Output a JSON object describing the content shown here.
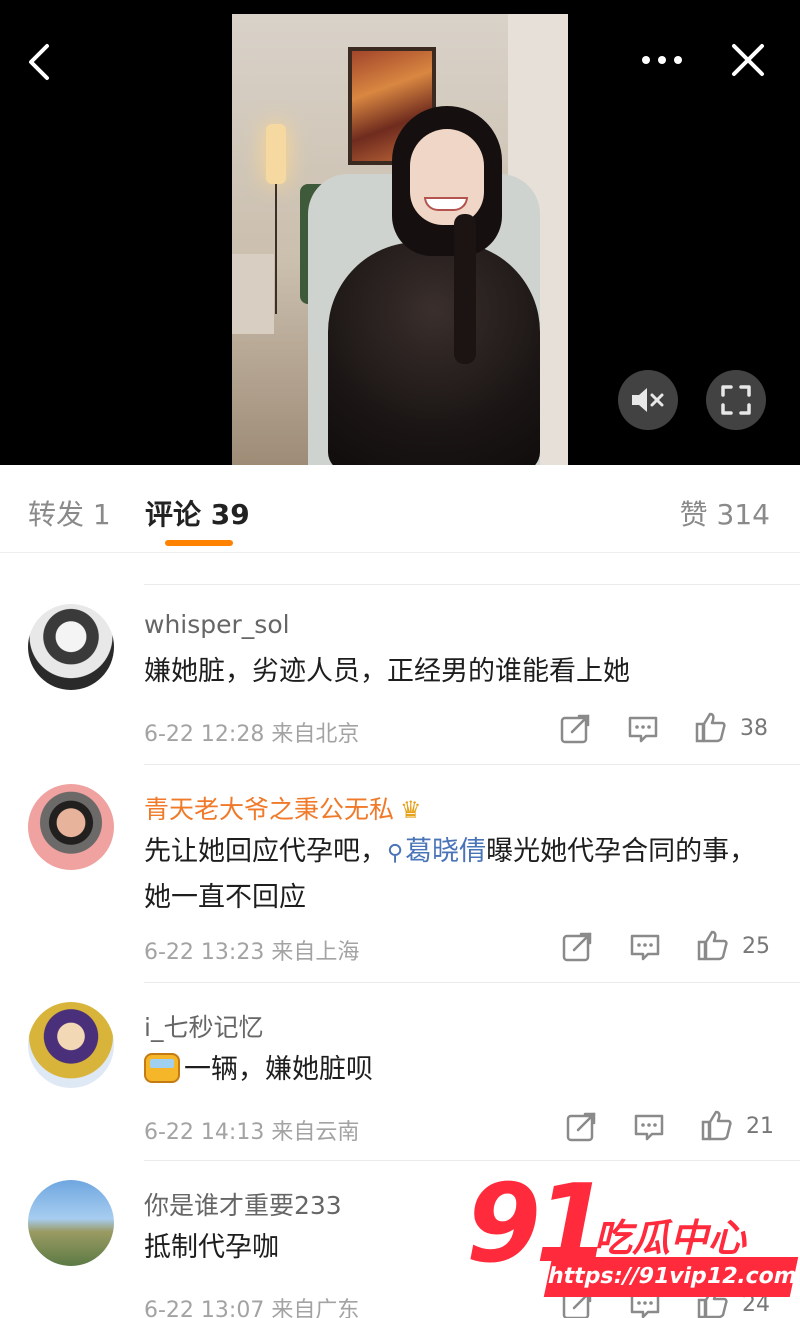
{
  "header": {
    "back_icon": "chevron-left-icon",
    "more_icon": "more-horizontal-icon",
    "close_icon": "close-icon",
    "mute_icon": "volume-muted-icon",
    "fullscreen_icon": "fullscreen-icon"
  },
  "tabs": {
    "repost": "转发 1",
    "comments": "评论 39",
    "likes": "赞 314"
  },
  "colors": {
    "accent": "#ff8200",
    "vip_name": "#f07a2a",
    "mention": "#4a74b8",
    "watermark": "#ff2a3c"
  },
  "comments": [
    {
      "username": "whisper_sol",
      "text": "嫌她脏，劣迹人员，正经男的谁能看上她",
      "time": "6-22 12:28",
      "location": "来自北京",
      "likes": "38"
    },
    {
      "username": "青天老大爷之秉公无私",
      "text_before": "先让她回应代孕吧，",
      "mention": "葛晓倩",
      "text_after": "曝光她代孕合同的事，她一直不回应",
      "time": "6-22 13:23",
      "location": "来自上海",
      "likes": "25"
    },
    {
      "username": "i_七秒记忆",
      "text": "一辆，嫌她脏呗",
      "time": "6-22 14:13",
      "location": "来自云南",
      "likes": "21"
    },
    {
      "username": "你是谁才重要233",
      "text": "抵制代孕咖",
      "time": "6-22 13:07",
      "location": "来自广东",
      "likes": "24"
    }
  ],
  "watermark": {
    "logo_number": "91",
    "name": "吃瓜中心",
    "url": "https://91vip12.com"
  }
}
